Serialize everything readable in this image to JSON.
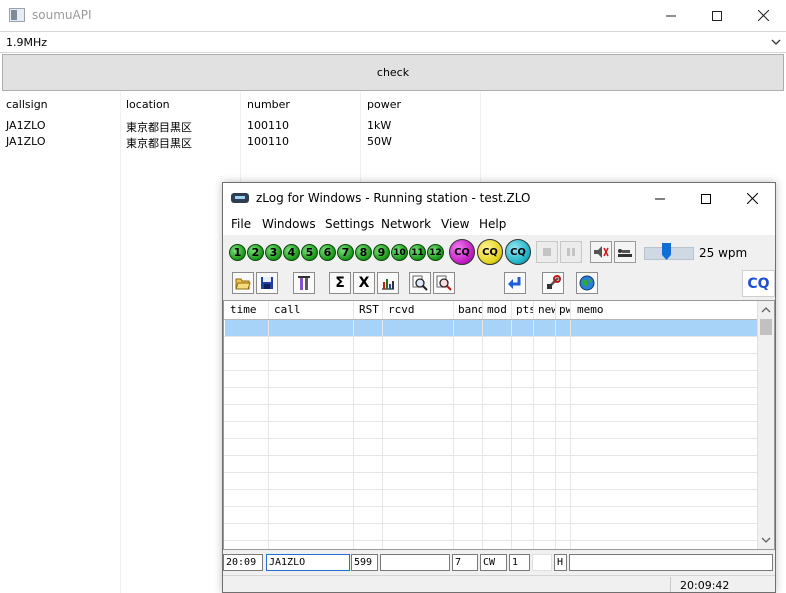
{
  "background_window": {
    "title": "soumuAPI",
    "band_select": {
      "selected": "1.9MHz"
    },
    "check_button": "check",
    "results": {
      "columns": [
        "callsign",
        "location",
        "number",
        "power"
      ],
      "rows": [
        [
          "JA1ZLO",
          "東京都目黒区",
          "100110",
          "1kW"
        ],
        [
          "JA1ZLO",
          "東京都目黒区",
          "100110",
          "50W"
        ]
      ]
    }
  },
  "zlog_window": {
    "title": "zLog for Windows - Running station - test.ZLO",
    "menu": [
      "File",
      "Windows",
      "Settings",
      "Network",
      "View",
      "Help"
    ],
    "memory_buttons": [
      "1",
      "2",
      "3",
      "4",
      "5",
      "6",
      "7",
      "8",
      "9",
      "10",
      "11",
      "12"
    ],
    "cq_buttons": [
      {
        "label": "CQ",
        "color": "#c21cc2"
      },
      {
        "label": "CQ",
        "color": "#e3d41c"
      },
      {
        "label": "CQ",
        "color": "#1fb3c8"
      }
    ],
    "speed": {
      "label": "25 wpm",
      "level_fraction": 0.45
    },
    "cq_indicator": "CQ",
    "toolbar2_glyphs": {
      "sigma": "Σ",
      "x": "X"
    },
    "log_columns": [
      "time",
      "call",
      "RST",
      "rcvd",
      "band",
      "mod",
      "pts",
      "new",
      "pwr",
      "memo"
    ],
    "entry": {
      "time": "20:09",
      "call": "JA1ZLO",
      "rst": "599",
      "rcvd": "",
      "band": "7",
      "mode": "CW",
      "power_code": "1",
      "extra": "",
      "pwr": "H",
      "memo": ""
    },
    "status_time": "20:09:42"
  },
  "colors": {
    "memory_green": "#1e9b1e",
    "selected_row": "#a7d3f9",
    "cq_text": "#1f4fd8",
    "button_face": "#e1e1e1"
  }
}
